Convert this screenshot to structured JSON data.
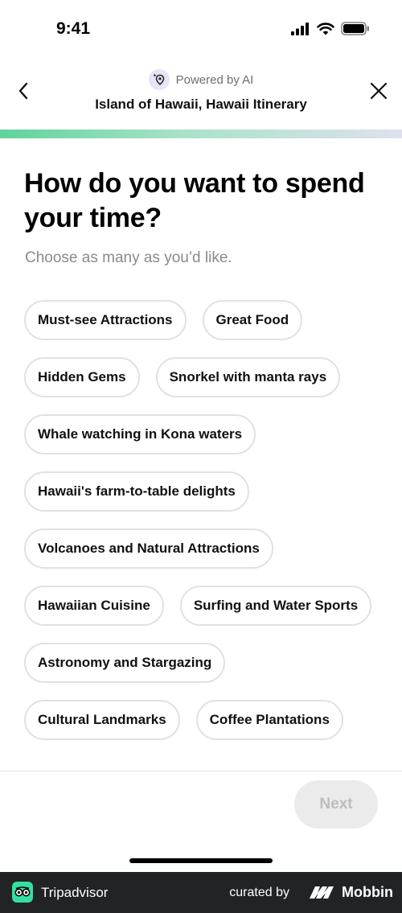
{
  "status_bar": {
    "time": "9:41"
  },
  "header": {
    "powered_by": "Powered by AI",
    "title": "Island of Hawaii, Hawaii Itinerary"
  },
  "progress": {
    "fraction": 1.0
  },
  "question": {
    "title": "How do you want to spend your time?",
    "subtitle": "Choose as many as you’d like."
  },
  "options": [
    {
      "label": "Must-see Attractions"
    },
    {
      "label": "Great Food"
    },
    {
      "label": "Hidden Gems"
    },
    {
      "label": "Snorkel with manta rays"
    },
    {
      "label": "Whale watching in Kona waters"
    },
    {
      "label": "Hawaii's farm-to-table delights"
    },
    {
      "label": "Volcanoes and Natural Attractions"
    },
    {
      "label": "Hawaiian Cuisine"
    },
    {
      "label": "Surfing and Water Sports"
    },
    {
      "label": "Astronomy and Stargazing"
    },
    {
      "label": "Cultural Landmarks"
    },
    {
      "label": "Coffee Plantations"
    }
  ],
  "footer_action": {
    "next_label": "Next"
  },
  "attribution": {
    "app_name": "Tripadvisor",
    "curated_by": "curated by",
    "brand": "Mobbin"
  },
  "colors": {
    "progress_start": "#5fd49b",
    "progress_end": "#dfe1ee",
    "next_disabled_bg": "#ebebeb",
    "tripadvisor_green": "#34e0a1"
  }
}
